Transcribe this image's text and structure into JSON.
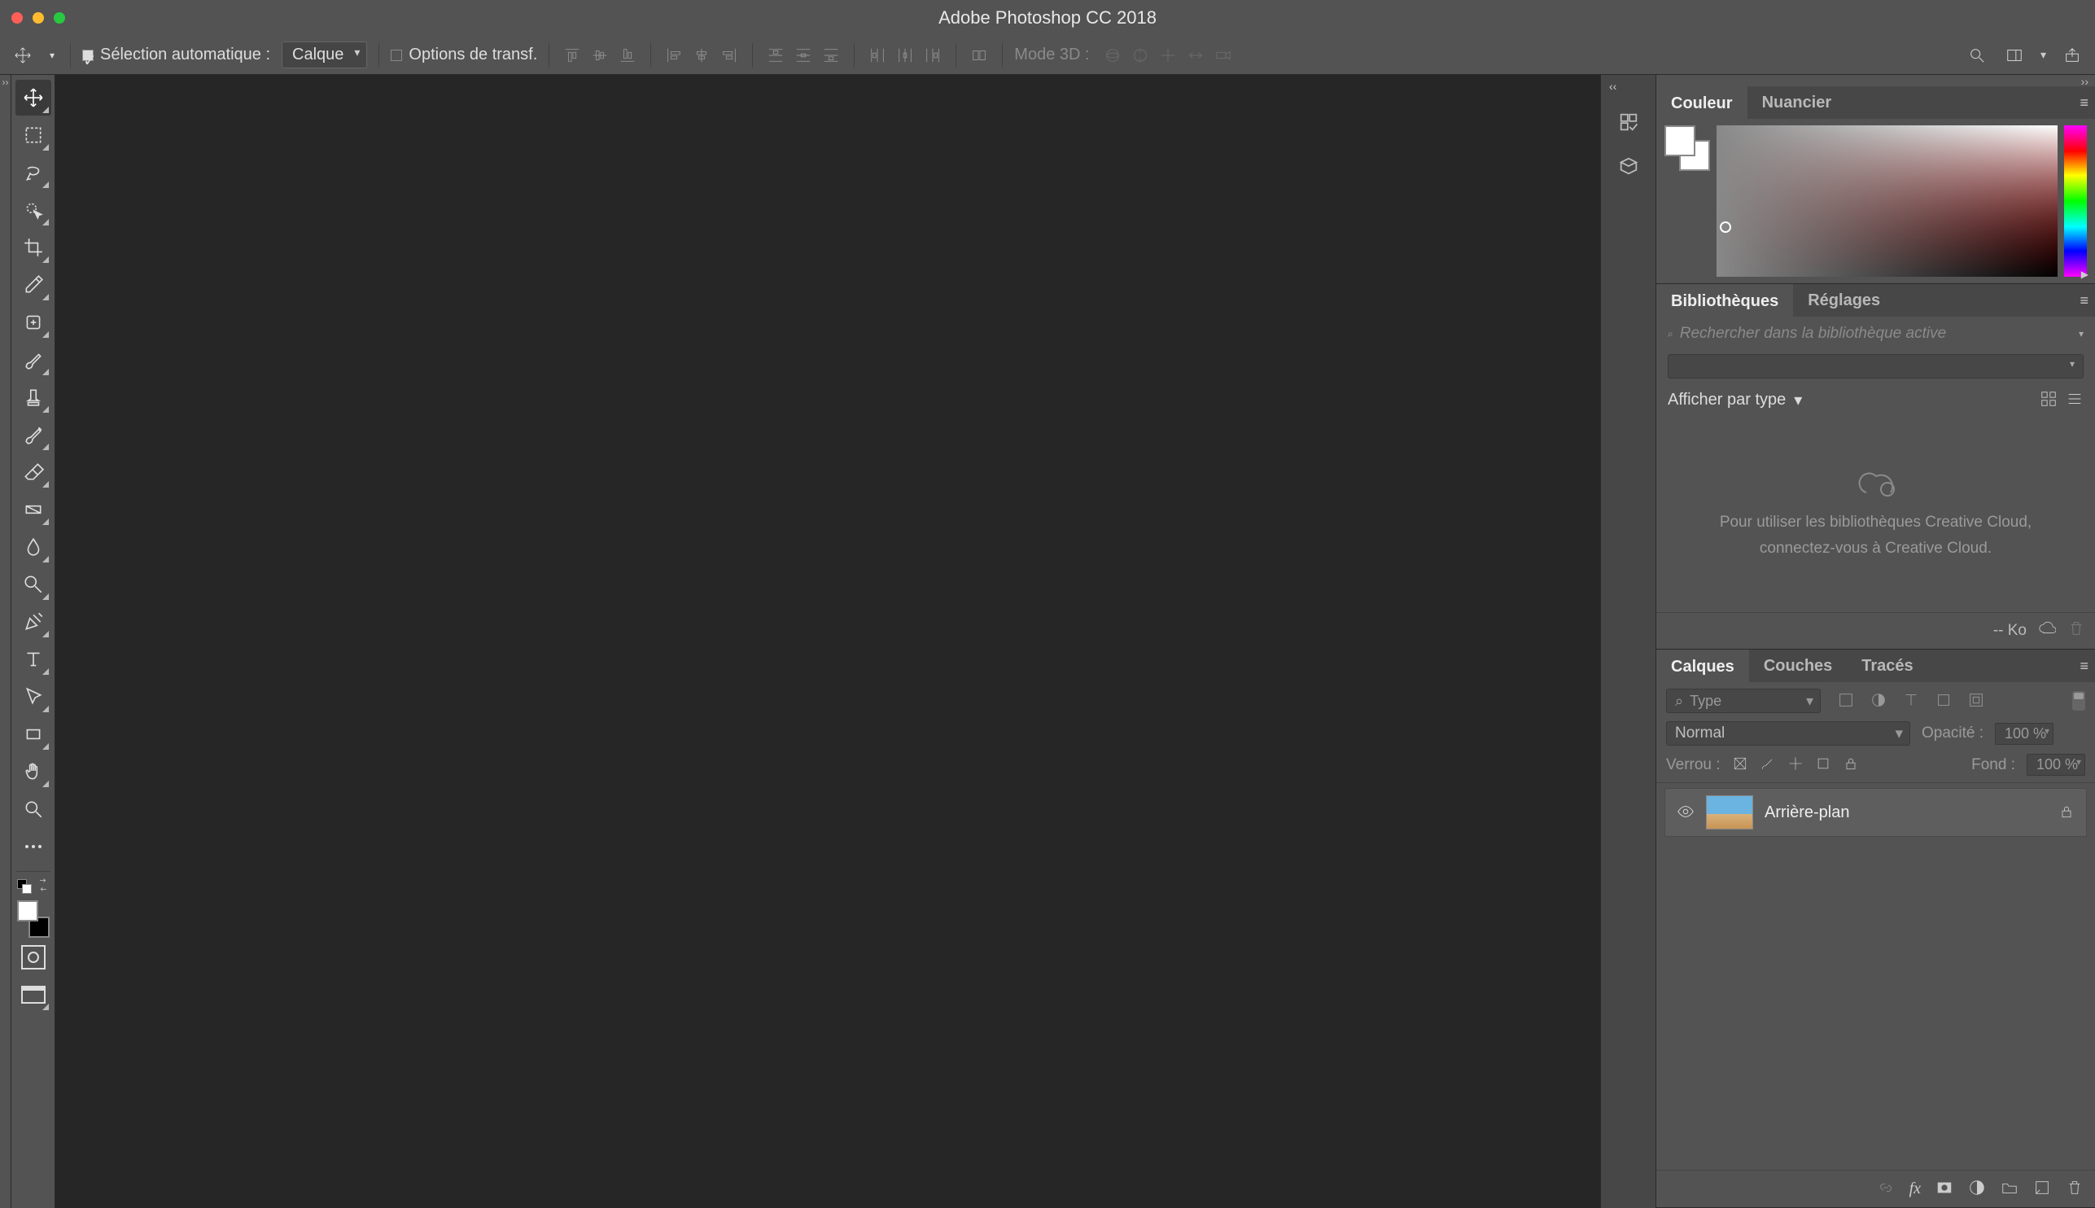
{
  "titlebar": {
    "title": "Adobe Photoshop CC 2018"
  },
  "options": {
    "selection_auto_label": "Sélection automatique :",
    "selection_auto_checked": true,
    "select_value": "Calque",
    "transform_label": "Options de transf.",
    "transform_checked": false,
    "mode3d_label": "Mode 3D :"
  },
  "tools": [
    {
      "name": "move-tool",
      "active": true
    },
    {
      "name": "marquee-tool"
    },
    {
      "name": "lasso-tool"
    },
    {
      "name": "quick-select-tool"
    },
    {
      "name": "crop-tool"
    },
    {
      "name": "eyedropper-tool"
    },
    {
      "name": "healing-brush-tool"
    },
    {
      "name": "brush-tool"
    },
    {
      "name": "clone-stamp-tool"
    },
    {
      "name": "history-brush-tool"
    },
    {
      "name": "eraser-tool"
    },
    {
      "name": "gradient-tool"
    },
    {
      "name": "blur-tool"
    },
    {
      "name": "dodge-tool"
    },
    {
      "name": "pen-tool"
    },
    {
      "name": "type-tool"
    },
    {
      "name": "path-select-tool"
    },
    {
      "name": "rectangle-shape-tool"
    },
    {
      "name": "hand-tool"
    },
    {
      "name": "zoom-tool"
    }
  ],
  "panel_color": {
    "tab_color": "Couleur",
    "tab_swatches": "Nuancier"
  },
  "panel_libraries": {
    "tab_libraries": "Bibliothèques",
    "tab_adjustments": "Réglages",
    "search_placeholder": "Rechercher dans la bibliothèque active",
    "filter_label": "Afficher par type",
    "empty_line1": "Pour utiliser les bibliothèques Creative Cloud,",
    "empty_line2": "connectez-vous à Creative Cloud.",
    "size_label": "-- Ko"
  },
  "panel_layers": {
    "tab_layers": "Calques",
    "tab_channels": "Couches",
    "tab_paths": "Tracés",
    "type_filter_label": "Type",
    "blend_mode": "Normal",
    "opacity_label": "Opacité :",
    "opacity_value": "100 %",
    "lock_label": "Verrou :",
    "fill_label": "Fond :",
    "fill_value": "100 %",
    "layers": [
      {
        "name": "Arrière-plan",
        "locked": true,
        "visible": true
      }
    ]
  }
}
